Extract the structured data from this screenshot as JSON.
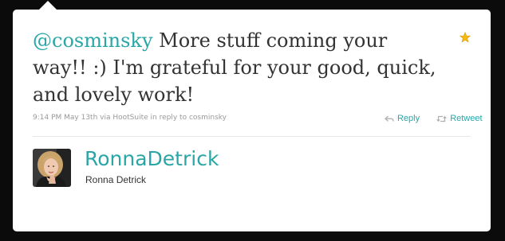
{
  "tweet": {
    "mention": "@cosminsky",
    "text": " More stuff coming your way!! :) I'm grateful for your good, quick, and lovely work!",
    "timestamp": "9:14 PM May 13th",
    "via_label": "via",
    "client": "HootSuite",
    "in_reply_label": "in reply to",
    "reply_to": "cosminsky"
  },
  "actions": {
    "reply_label": "Reply",
    "retweet_label": "Retweet"
  },
  "author": {
    "screen_name": "RonnaDetrick",
    "full_name": "Ronna Detrick"
  },
  "icons": {
    "favorite": "star-icon",
    "reply": "reply-arrow-icon",
    "retweet": "retweet-icon"
  },
  "colors": {
    "accent": "#2aa6a6",
    "star": "#f5b913",
    "background": "#0b0b0b",
    "card": "#ffffff",
    "meta_text": "#999999"
  }
}
